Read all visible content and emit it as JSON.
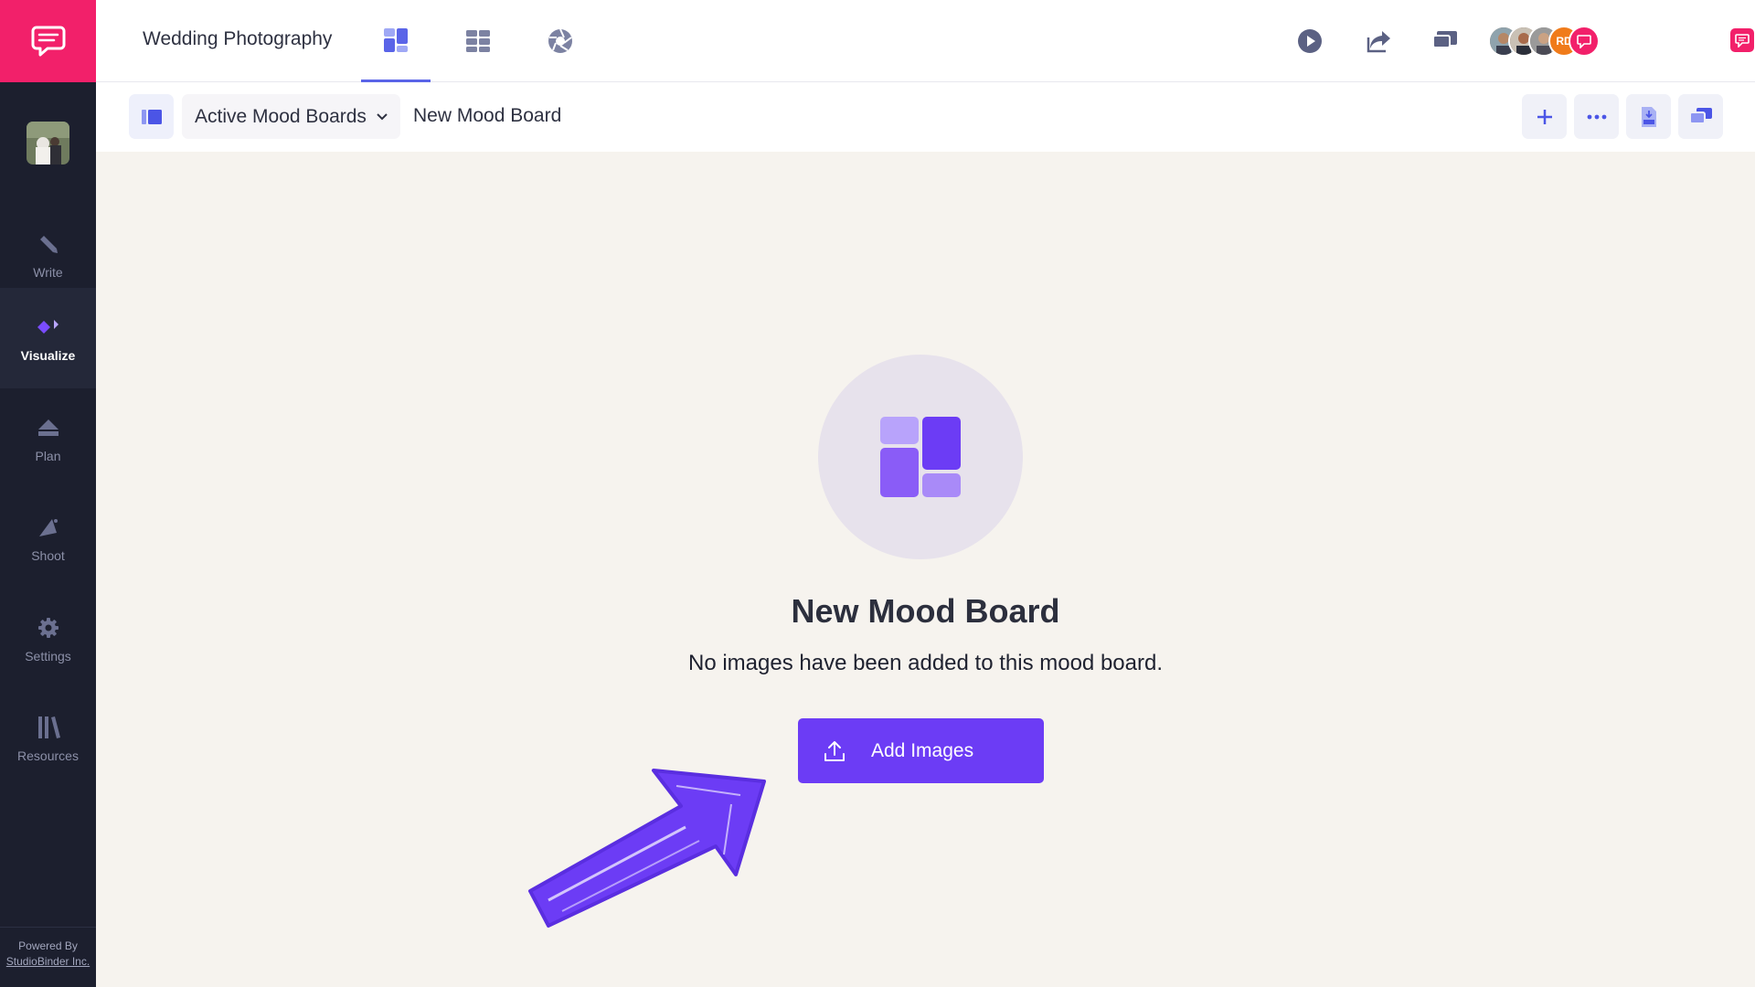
{
  "colors": {
    "brand_pink": "#f2206a",
    "sidebar_bg": "#1c1f2e",
    "accent_purple": "#6c3cf5",
    "tab_indicator": "#5a64e8",
    "content_bg": "#f6f3ee"
  },
  "sidebar": {
    "logo_icon": "chat-bubble-logo-icon",
    "items": [
      {
        "label": "Write",
        "icon": "pencil-icon"
      },
      {
        "label": "Visualize",
        "icon": "visualize-icon",
        "active": true
      },
      {
        "label": "Plan",
        "icon": "plan-icon"
      },
      {
        "label": "Shoot",
        "icon": "shoot-icon"
      },
      {
        "label": "Settings",
        "icon": "gear-icon"
      },
      {
        "label": "Resources",
        "icon": "books-icon"
      }
    ],
    "powered_by": "Powered By",
    "company": "StudioBinder Inc."
  },
  "header": {
    "project_title": "Wedding Photography",
    "tabs": [
      {
        "icon": "mood-board-icon",
        "active": true
      },
      {
        "icon": "shot-grid-icon"
      },
      {
        "icon": "aperture-icon"
      }
    ],
    "actions": [
      "play-icon",
      "share-icon",
      "present-icon"
    ],
    "collaborators": [
      "avatar",
      "avatar",
      "avatar",
      "RD"
    ],
    "user_status": "online"
  },
  "subheader": {
    "board_selector": "Active Mood Boards",
    "board_name": "New Mood Board",
    "actions": [
      "add-icon",
      "more-icon",
      "pdf-download-icon",
      "present-icon"
    ]
  },
  "empty_state": {
    "title": "New Mood Board",
    "description": "No images have been added to this mood board.",
    "button_label": "Add Images",
    "button_icon": "upload-icon"
  }
}
